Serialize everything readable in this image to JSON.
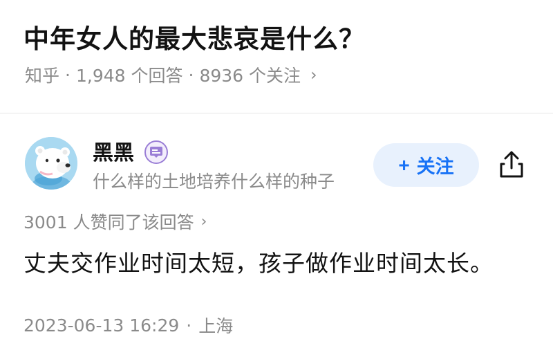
{
  "question": {
    "title": "中年女人的最大悲哀是什么？",
    "source": "知乎",
    "answer_count": "1,948 个回答",
    "follow_count": "8936 个关注",
    "separator": "·",
    "chevron": "›"
  },
  "answer": {
    "author_name": "黑黑",
    "author_bio": "什么样的土地培养什么样的种子",
    "follow_label": "关注",
    "follow_plus": "+",
    "votes_text": "3001 人赞同了该回答",
    "votes_chevron": "›",
    "content": "丈夫交作业时间太短，孩子做作业时间太长。",
    "date": "2023-06-13 16:29",
    "separator": "·",
    "location": "上海"
  },
  "icons": {
    "avatar": "polar-bear-avatar",
    "badge": "certification-badge-icon",
    "share": "share-icon"
  },
  "colors": {
    "accent": "#1772f6",
    "follow_bg": "#e8f1fd",
    "muted_text": "#8a8a8a",
    "badge": "#9a7ed6",
    "avatar_bg": "#a9d9f1"
  }
}
